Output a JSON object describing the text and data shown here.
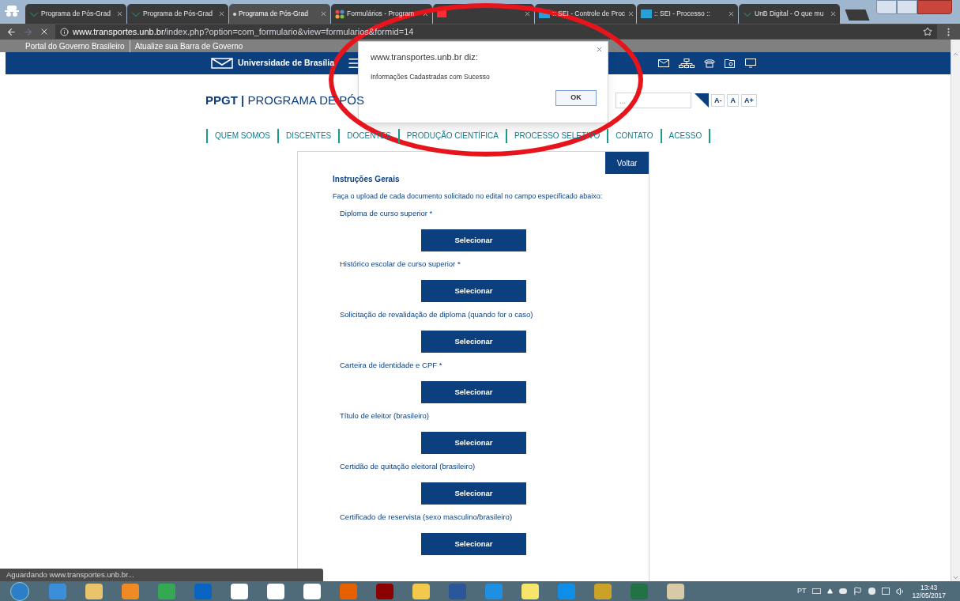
{
  "browser": {
    "tabs": [
      {
        "title": "Programa de Pós-Grad",
        "kind": "unb",
        "selected": false
      },
      {
        "title": "Programa de Pós-Grad",
        "kind": "unb",
        "selected": false
      },
      {
        "title": "Programa de Pós-Grad",
        "kind": "loading",
        "selected": true
      },
      {
        "title": "Formulários - Program",
        "kind": "joomla",
        "selected": false
      },
      {
        "kind": "mail",
        "selected": false
      },
      {
        "title": ":: SEI - Controle de Proc",
        "kind": "sei",
        "selected": false
      },
      {
        "title": ":: SEI - Processo ::",
        "kind": "sei",
        "selected": false
      },
      {
        "title": "UnB Digital - O que mu",
        "kind": "unb",
        "selected": false
      }
    ],
    "address": {
      "host": "www.transportes.unb.br",
      "path": "/index.php?option=com_formulario&view=formularios&formid=14"
    },
    "gov_bar": [
      "Portal do Governo Brasileiro",
      "Atualize sua Barra de Governo"
    ],
    "status": "Aguardando www.transportes.unb.br..."
  },
  "page": {
    "header": {
      "brand": "Universidade de Brasília"
    },
    "title": {
      "acronym": "PPGT",
      "separator": "|",
      "name": "PROGRAMA DE PÓS"
    },
    "search": {
      "placeholder": "..."
    },
    "font_buttons": [
      "A-",
      "A",
      "A+"
    ],
    "nav": [
      "QUEM SOMOS",
      "DISCENTES",
      "DOCENTES",
      "PRODUÇÃO CIENTÍFICA",
      "PROCESSO SELETIVO",
      "CONTATO",
      "ACESSO"
    ],
    "form": {
      "back": "Voltar",
      "heading": "Instruções Gerais",
      "intro": "Faça o upload de cada documento solicitado no edital no campo especificado abaixo:",
      "fields": [
        {
          "label": "Diploma de curso superior *",
          "button": "Selecionar"
        },
        {
          "label": "Histórico escolar de curso superior *",
          "button": "Selecionar"
        },
        {
          "label": "Solicitação de revalidação de diploma (quando for o caso)",
          "button": "Selecionar"
        },
        {
          "label": "Carteira de identidade e CPF *",
          "button": "Selecionar"
        },
        {
          "label": "Título de eleitor (brasileiro)",
          "button": "Selecionar"
        },
        {
          "label": "Certidão de quitação eleitoral (brasileiro)",
          "button": "Selecionar"
        },
        {
          "label": "Certificado de reservista (sexo masculino/brasileiro)",
          "button": "Selecionar"
        }
      ]
    }
  },
  "dialog": {
    "title": "www.transportes.unb.br diz:",
    "message": "Informações Cadastradas com Sucesso",
    "ok": "OK"
  },
  "taskbar": {
    "language": "PT",
    "time": "13:43",
    "date": "12/05/2017"
  }
}
